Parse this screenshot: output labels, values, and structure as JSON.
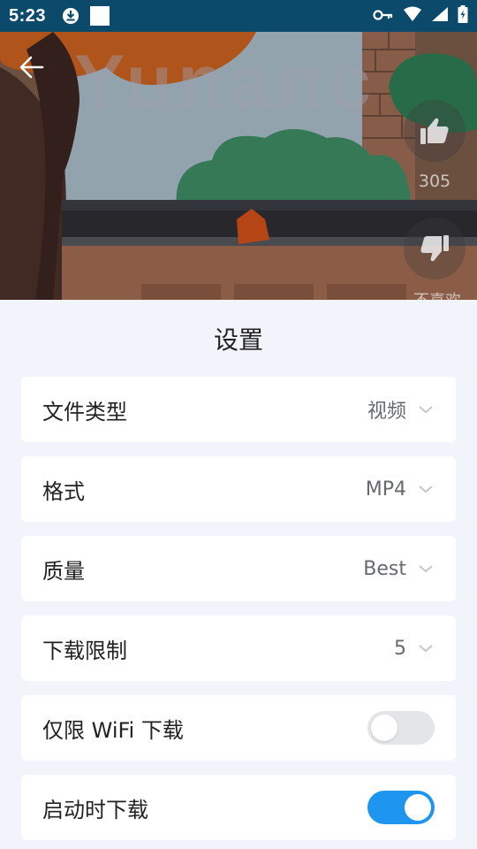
{
  "status_bar": {
    "time": "5:23",
    "background": "#0b4a6b",
    "icons": [
      "download-icon",
      "notification-square-icon",
      "vpn-key-icon",
      "wifi-icon",
      "signal-icon",
      "battery-icon"
    ]
  },
  "video": {
    "watermark": "Yunanc",
    "like_count": "305",
    "dislike_label": "不喜欢"
  },
  "settings": {
    "title": "设置",
    "file_type": {
      "label": "文件类型",
      "value": "视频"
    },
    "format": {
      "label": "格式",
      "value": "MP4"
    },
    "quality": {
      "label": "质量",
      "value": "Best"
    },
    "download_limit": {
      "label": "下载限制",
      "value": "5"
    },
    "wifi_only": {
      "label": "仅限 WiFi 下载",
      "enabled": false
    },
    "download_on_start": {
      "label": "启动时下载",
      "enabled": true
    }
  },
  "colors": {
    "accent": "#1e95ee",
    "sheet_bg": "#f1f4fb",
    "toggle_off": "#e4e5e8"
  }
}
